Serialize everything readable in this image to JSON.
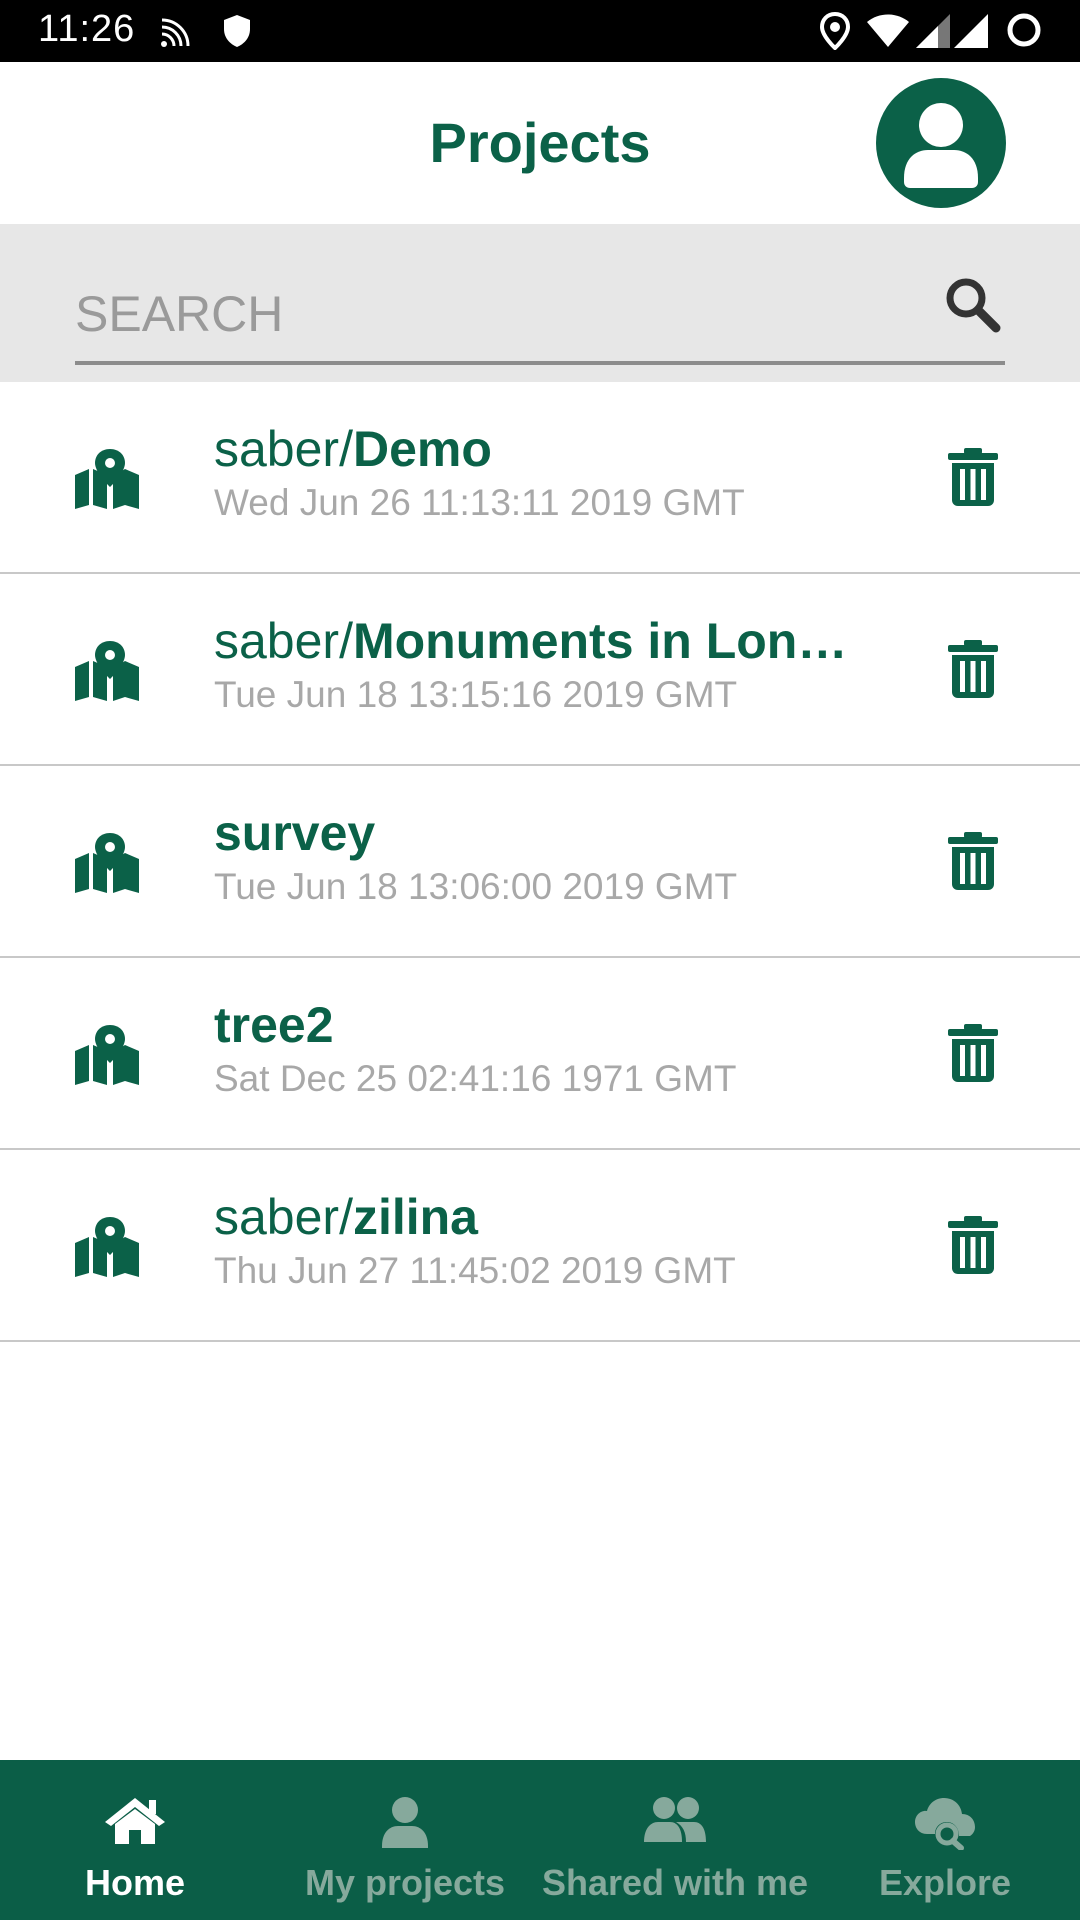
{
  "status_bar": {
    "time": "11:26",
    "icons": [
      "cast-icon",
      "shield-icon",
      "location-icon",
      "wifi-icon",
      "signal-icon",
      "signal-icon",
      "sync-icon"
    ]
  },
  "header": {
    "title": "Projects",
    "avatar_icon": "user-icon"
  },
  "search": {
    "placeholder": "SEARCH",
    "value": "",
    "icon": "search-icon"
  },
  "projects": [
    {
      "namespace": "saber/",
      "name": "Demo",
      "date": "Wed Jun 26 11:13:11 2019 GMT"
    },
    {
      "namespace": "saber/",
      "name": "Monuments in Lon…",
      "date": "Tue Jun 18 13:15:16 2019 GMT"
    },
    {
      "namespace": "",
      "name": "survey",
      "date": "Tue Jun 18 13:06:00 2019 GMT"
    },
    {
      "namespace": "",
      "name": "tree2",
      "date": "Sat Dec 25 02:41:16 1971 GMT"
    },
    {
      "namespace": "saber/",
      "name": "zilina",
      "date": "Thu Jun 27 11:45:02 2019 GMT"
    }
  ],
  "bottom_nav": [
    {
      "label": "Home",
      "icon": "home-icon",
      "active": true
    },
    {
      "label": "My projects",
      "icon": "person-icon",
      "active": false
    },
    {
      "label": "Shared with me",
      "icon": "people-icon",
      "active": false
    },
    {
      "label": "Explore",
      "icon": "cloud-search-icon",
      "active": false
    }
  ],
  "colors": {
    "brand_green": "#0b6148",
    "nav_background": "#0b5e47",
    "nav_inactive": "#86a99c",
    "date_gray": "#a8a8a8",
    "search_background": "#e7e7e7"
  }
}
